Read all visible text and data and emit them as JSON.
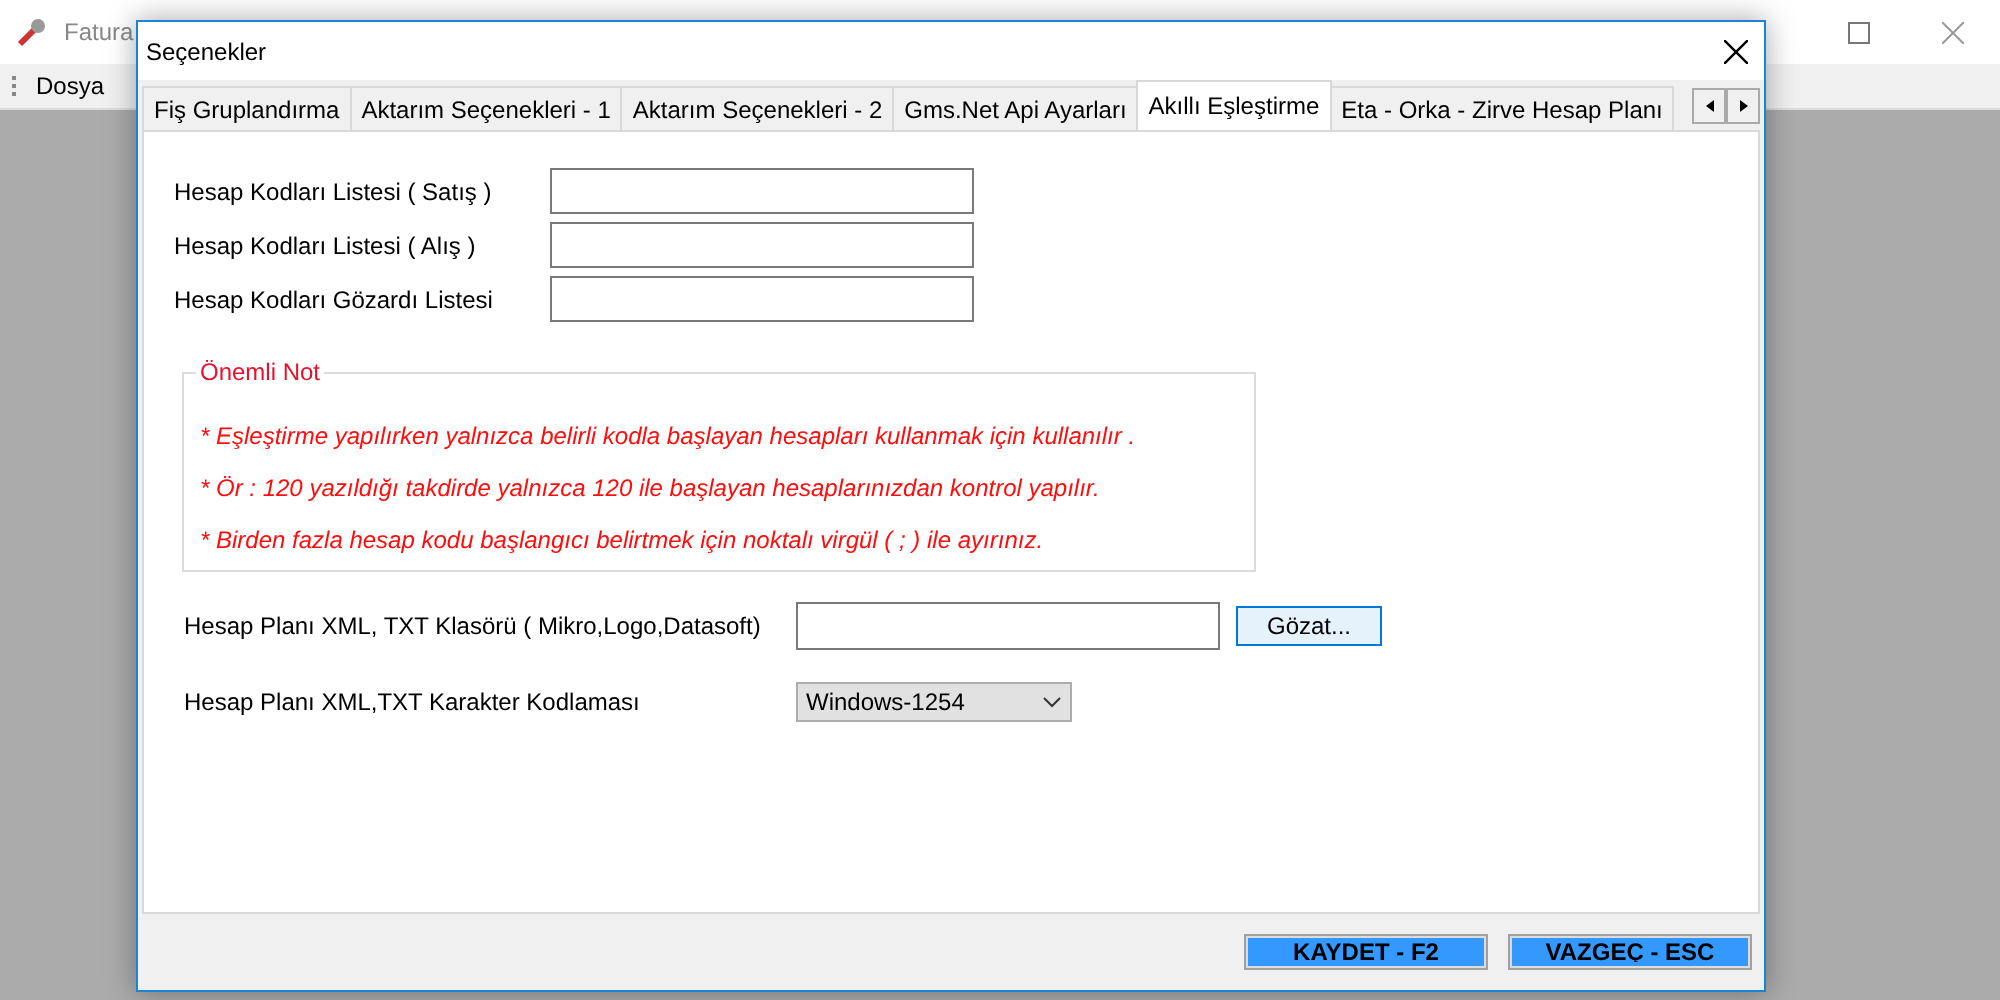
{
  "app": {
    "title": "Fatura",
    "menu": [
      "Dosya"
    ]
  },
  "dialog": {
    "title": "Seçenekler",
    "tabs": [
      {
        "label": "Fiş Gruplandırma",
        "selected": false
      },
      {
        "label": "Aktarım Seçenekleri - 1",
        "selected": false
      },
      {
        "label": "Aktarım Seçenekleri - 2",
        "selected": false
      },
      {
        "label": "Gms.Net Api Ayarları",
        "selected": false
      },
      {
        "label": "Akıllı Eşleştirme",
        "selected": true
      },
      {
        "label": "Eta - Orka - Zirve Hesap Planı",
        "selected": false
      }
    ],
    "fields": [
      {
        "label": "Hesap Kodları Listesi ( Satış )"
      },
      {
        "label": "Hesap Kodları Listesi ( Alış )"
      },
      {
        "label": "Hesap Kodları Gözardı Listesi"
      }
    ],
    "note": {
      "title": "Önemli Not",
      "lines": [
        "* Eşleştirme yapılırken yalnızca belirli kodla başlayan hesapları kullanmak için kullanılır .",
        "* Ör : 120 yazıldığı takdirde yalnızca 120 ile başlayan hesaplarınızdan kontrol yapılır.",
        "* Birden fazla hesap kodu başlangıcı belirtmek için noktalı virgül ( ; ) ile ayırınız."
      ]
    },
    "folder": {
      "label": "Hesap Planı XML, TXT Klasörü ( Mikro,Logo,Datasoft)",
      "button": "Gözat..."
    },
    "encoding": {
      "label": "Hesap Planı XML,TXT Karakter Kodlaması",
      "value": "Windows-1254"
    },
    "buttons": [
      "KAYDET - F2",
      "VAZGEÇ - ESC"
    ]
  }
}
